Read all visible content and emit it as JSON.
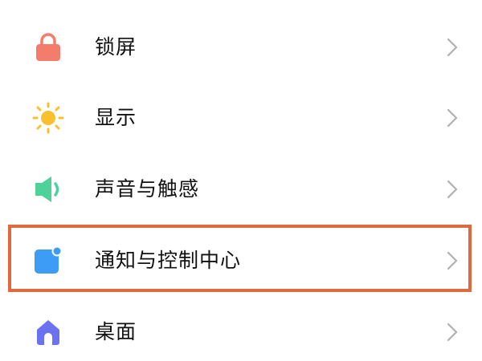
{
  "settings": {
    "items": [
      {
        "label": "锁屏",
        "icon": "lock-icon",
        "color": "#f47c6b"
      },
      {
        "label": "显示",
        "icon": "sun-icon",
        "color": "#f8c02f"
      },
      {
        "label": "声音与触感",
        "icon": "speaker-icon",
        "color": "#4fd19a"
      },
      {
        "label": "通知与控制中心",
        "icon": "notification-icon",
        "color": "#3d9cf5"
      },
      {
        "label": "桌面",
        "icon": "home-icon",
        "color": "#6b72f0"
      }
    ]
  },
  "highlight": {
    "color": "#e06a3f",
    "target": "通知与控制中心"
  },
  "chevron_color": "#b0b0b0"
}
